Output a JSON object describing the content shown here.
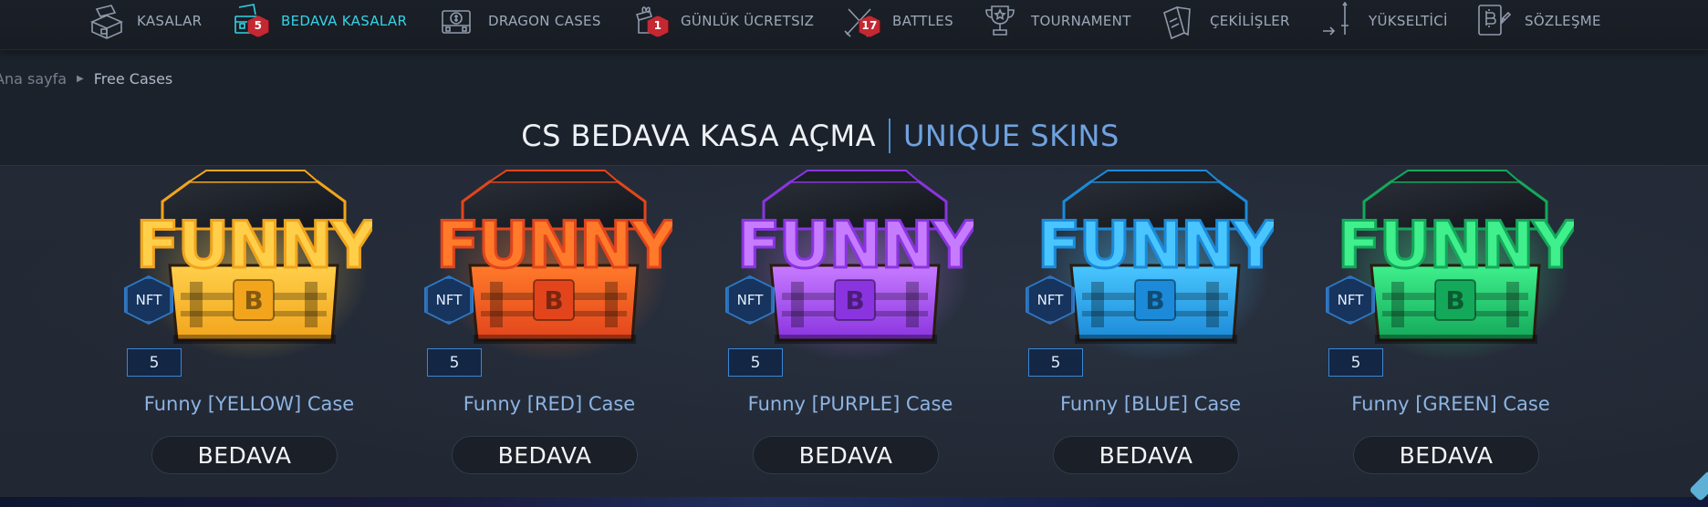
{
  "nav": {
    "items": [
      {
        "label": "KASALAR",
        "icon": "case-icon",
        "badge": ""
      },
      {
        "label": "BEDAVA KASALAR",
        "icon": "free-case-icon",
        "badge": "5"
      },
      {
        "label": "DRAGON CASES",
        "icon": "dollar-case-icon",
        "badge": ""
      },
      {
        "label": "GÜNLÜK ÜCRETSIZ",
        "icon": "gift-icon",
        "badge": "1"
      },
      {
        "label": "BATTLES",
        "icon": "crossed-swords-icon",
        "badge": "17"
      },
      {
        "label": "TOURNAMENT",
        "icon": "trophy-icon",
        "badge": ""
      },
      {
        "label": "ÇEKİLİŞLER",
        "icon": "cards-icon",
        "badge": ""
      },
      {
        "label": "YÜKSELTİCİ",
        "icon": "upgrade-sword-icon",
        "badge": ""
      },
      {
        "label": "SÖZLEŞME",
        "icon": "contract-icon",
        "badge": ""
      }
    ],
    "active_index": 1,
    "colors": {
      "text": "#9ea9b8",
      "active": "#33d3e6",
      "badge": "#c42832"
    }
  },
  "breadcrumb": {
    "home": "Ana sayfa",
    "current": "Free Cases"
  },
  "title": {
    "main": "CS BEDAVA KASA AÇMA",
    "accent": "UNIQUE SKINS"
  },
  "cases": [
    {
      "name": "Funny [YELLOW] Case",
      "count": "5",
      "badge": "NFT",
      "button": "BEDAVA",
      "color": "#f2a41c",
      "glow": "#ffcf4a"
    },
    {
      "name": "Funny [RED] Case",
      "count": "5",
      "badge": "NFT",
      "button": "BEDAVA",
      "color": "#e2451c",
      "glow": "#ff7a2a"
    },
    {
      "name": "Funny [PURPLE] Case",
      "count": "5",
      "badge": "NFT",
      "button": "BEDAVA",
      "color": "#8a34e0",
      "glow": "#c77bff"
    },
    {
      "name": "Funny [BLUE] Case",
      "count": "5",
      "badge": "NFT",
      "button": "BEDAVA",
      "color": "#1c8ad8",
      "glow": "#49c6ff"
    },
    {
      "name": "Funny [GREEN] Case",
      "count": "5",
      "badge": "NFT",
      "button": "BEDAVA",
      "color": "#14a85a",
      "glow": "#3ff08c"
    }
  ],
  "case_art_text": "FUNNY",
  "colors": {
    "background": "#1c222c",
    "strip": "#232935",
    "case_name": "#8db4e3",
    "title_accent": "#6fa2e0",
    "count_border": "#3a86d6"
  }
}
